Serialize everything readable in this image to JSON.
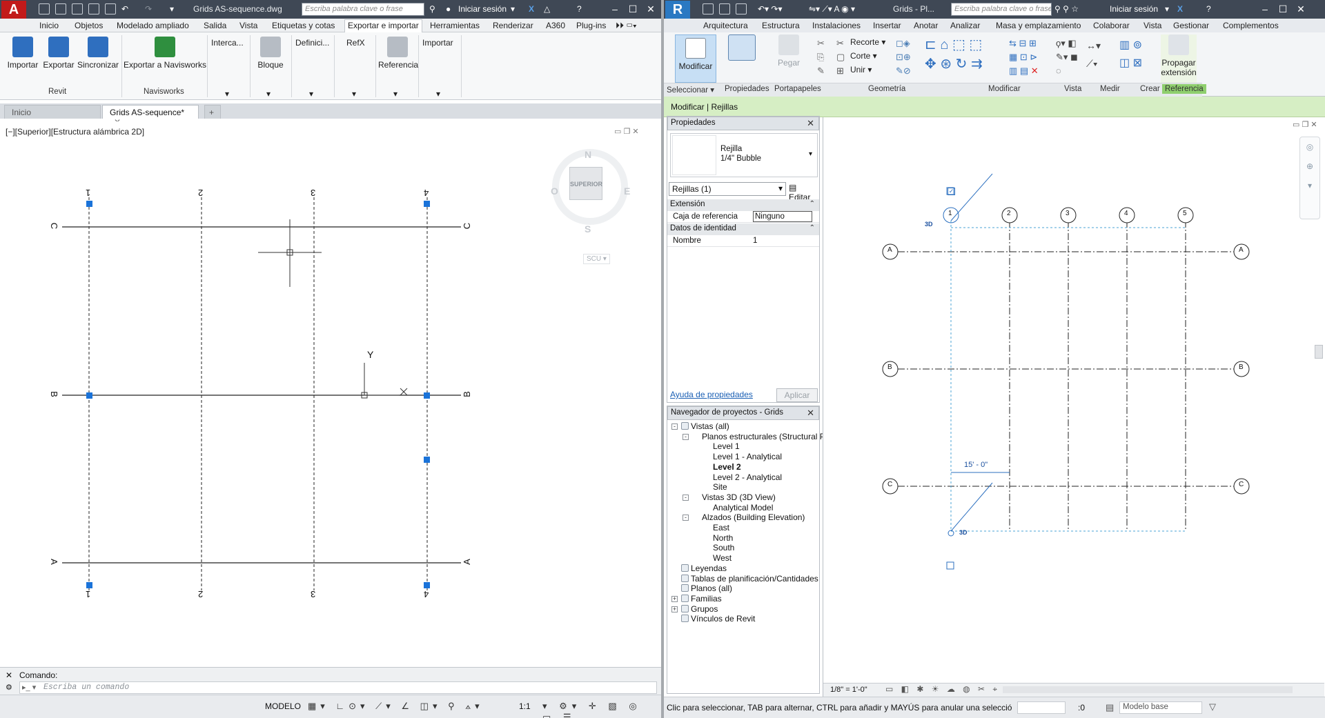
{
  "acad": {
    "title": "Grids AS-sequence.dwg",
    "search_placeholder": "Escriba palabra clave o frase",
    "signin": "Iniciar sesión",
    "tabs": [
      "Inicio",
      "Objetos",
      "Modelado ampliado",
      "Salida",
      "Vista",
      "Etiquetas y cotas",
      "Exportar e importar",
      "Herramientas",
      "Renderizar",
      "A360",
      "Plug-ins"
    ],
    "active_tab_index": 6,
    "ribbon": {
      "import": "Importar",
      "export": "Exportar",
      "sync": "Sincronizar",
      "export_navisworks": "Exportar a Navisworks",
      "panel_revit": "Revit",
      "panel_navisworks": "Navisworks",
      "interca": "Interca...",
      "bloque": "Bloque",
      "definici": "Definici...",
      "refx": "RefX",
      "referencia": "Referencia",
      "importar": "Importar"
    },
    "doc_tabs": [
      "Inicio",
      "Grids AS-sequence*"
    ],
    "viewport_label": "[−][Superior][Estructura alámbrica 2D]",
    "viewcube": {
      "n": "N",
      "s": "S",
      "e": "E",
      "w": "O",
      "face": "SUPERIOR",
      "ucs": "SCU"
    },
    "grid_top_labels": [
      "1",
      "2",
      "3",
      "4"
    ],
    "grid_side_labels": [
      "C",
      "B",
      "A"
    ],
    "ucs_y": "Y",
    "ucs_x": "X",
    "command_label": "Comando:",
    "command_placeholder": "Escriba un comando",
    "status": {
      "model": "MODELO",
      "scale": "1:1"
    }
  },
  "revit": {
    "title": "Grids - Pl...",
    "search_placeholder": "Escriba palabra clave o frase",
    "signin": "Iniciar sesión",
    "tabs": [
      "Arquitectura",
      "Estructura",
      "Instalaciones",
      "Insertar",
      "Anotar",
      "Analizar",
      "Masa y emplazamiento",
      "Colaborar",
      "Vista",
      "Gestionar",
      "Complementos"
    ],
    "ribbon": {
      "modificar": "Modificar",
      "pegar": "Pegar",
      "recorte": "Recorte",
      "corte": "Corte",
      "unir": "Unir",
      "propagar": "Propagar extensión",
      "panels": [
        "Seleccionar",
        "Propiedades",
        "Portapapeles",
        "Geometría",
        "Modificar",
        "Vista",
        "Medir",
        "Crear",
        "Referencia"
      ]
    },
    "context_bar": "Modificar | Rejillas",
    "properties": {
      "header": "Propiedades",
      "type_name": "Rejilla",
      "type_sub": "1/4\" Bubble",
      "selector": "Rejillas (1)",
      "edit_type": "Editar tipo",
      "group_extension": "Extensión",
      "caja_label": "Caja de referencia",
      "caja_value": "Ninguno",
      "group_identity": "Datos de identidad",
      "nombre_label": "Nombre",
      "nombre_value": "1",
      "help_link": "Ayuda de propiedades",
      "apply": "Aplicar"
    },
    "browser": {
      "header": "Navegador de proyectos - Grids",
      "items": [
        {
          "text": "Vistas (all)",
          "level": 0,
          "exp": "-"
        },
        {
          "text": "Planos estructurales (Structural Plan)",
          "level": 1,
          "exp": "-"
        },
        {
          "text": "Level 1",
          "level": 2
        },
        {
          "text": "Level 1 - Analytical",
          "level": 2
        },
        {
          "text": "Level 2",
          "level": 2,
          "bold": true
        },
        {
          "text": "Level 2 - Analytical",
          "level": 2
        },
        {
          "text": "Site",
          "level": 2
        },
        {
          "text": "Vistas 3D (3D View)",
          "level": 1,
          "exp": "-"
        },
        {
          "text": "Analytical Model",
          "level": 2
        },
        {
          "text": "Alzados (Building Elevation)",
          "level": 1,
          "exp": "-"
        },
        {
          "text": "East",
          "level": 2
        },
        {
          "text": "North",
          "level": 2
        },
        {
          "text": "South",
          "level": 2
        },
        {
          "text": "West",
          "level": 2
        },
        {
          "text": "Leyendas",
          "level": 0
        },
        {
          "text": "Tablas de planificación/Cantidades",
          "level": 0
        },
        {
          "text": "Planos (all)",
          "level": 0
        },
        {
          "text": "Familias",
          "level": 0,
          "exp": "+"
        },
        {
          "text": "Grupos",
          "level": 0,
          "exp": "+"
        },
        {
          "text": "Vínculos de Revit",
          "level": 0
        }
      ]
    },
    "grid_numbers": [
      "1",
      "2",
      "3",
      "4",
      "5"
    ],
    "grid_letters": [
      "A",
      "B",
      "C"
    ],
    "label_3d": "3D",
    "dimension": "15' - 0\"",
    "view_scale": "1/8\" = 1'-0\"",
    "status_text": "Clic para seleccionar, TAB para alternar, CTRL para añadir y MAYÚS para anular una selecció",
    "status_zero": ":0",
    "status_model": "Modelo base"
  }
}
